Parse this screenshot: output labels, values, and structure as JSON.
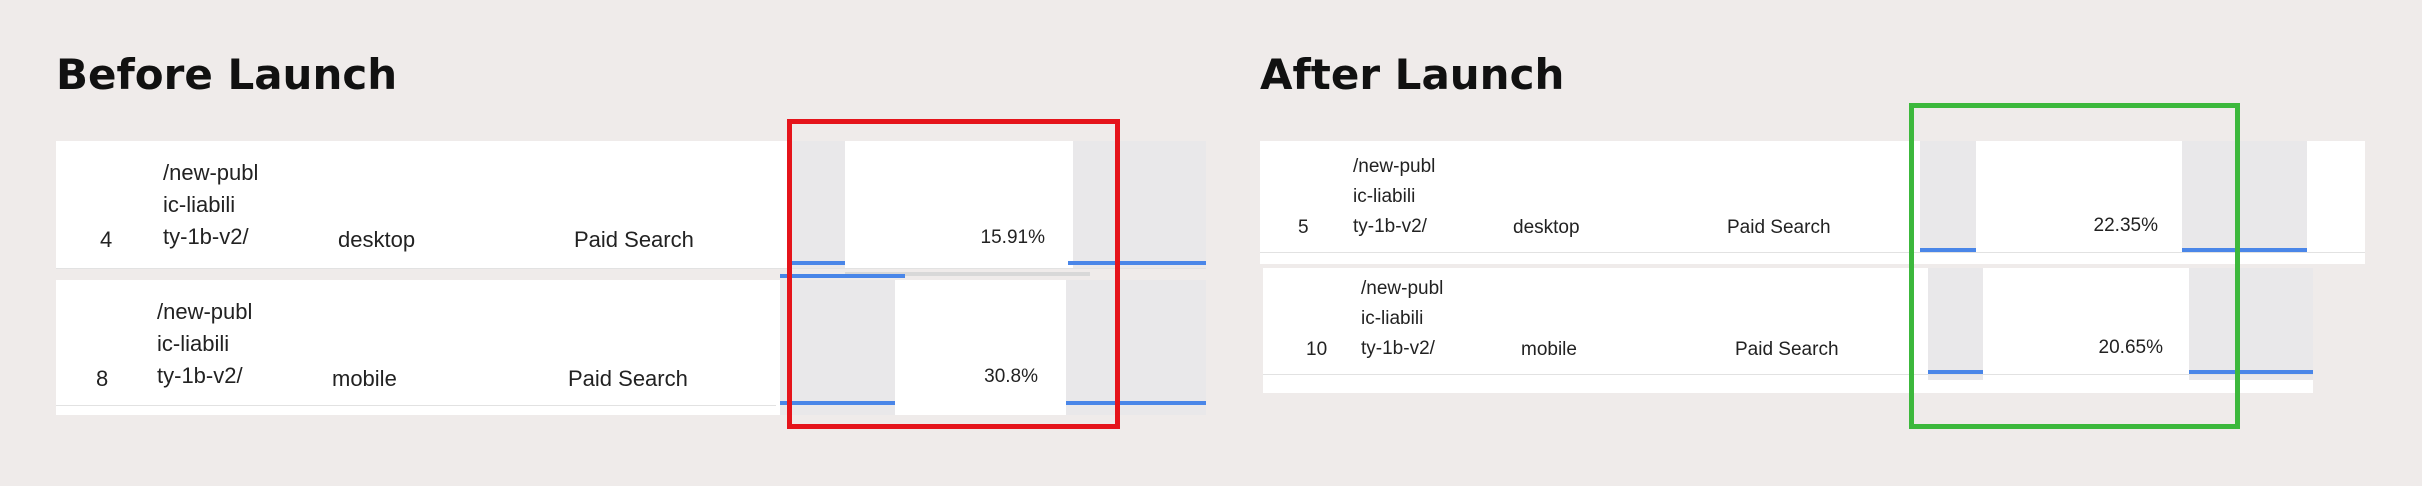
{
  "before": {
    "title": "Before Launch",
    "rows": [
      {
        "rank": "4",
        "page": "/new-publ\nic-liabili\nty-1b-v2/",
        "device": "desktop",
        "channel": "Paid Search",
        "rate": "15.91%"
      },
      {
        "rank": "8",
        "page": "/new-publ\nic-liabili\nty-1b-v2/",
        "device": "mobile",
        "channel": "Paid Search",
        "rate": "30.8%"
      }
    ],
    "highlight_color": "#e5141b"
  },
  "after": {
    "title": "After Launch",
    "rows": [
      {
        "rank": "5",
        "page": "/new-publ\nic-liabili\nty-1b-v2/",
        "device": "desktop",
        "channel": "Paid Search",
        "rate": "22.35%"
      },
      {
        "rank": "10",
        "page": "/new-publ\nic-liabili\nty-1b-v2/",
        "device": "mobile",
        "channel": "Paid Search",
        "rate": "20.65%"
      }
    ],
    "highlight_color": "#3cb83c"
  },
  "colors": {
    "background": "#efebea",
    "bar": "#4a86e8"
  }
}
